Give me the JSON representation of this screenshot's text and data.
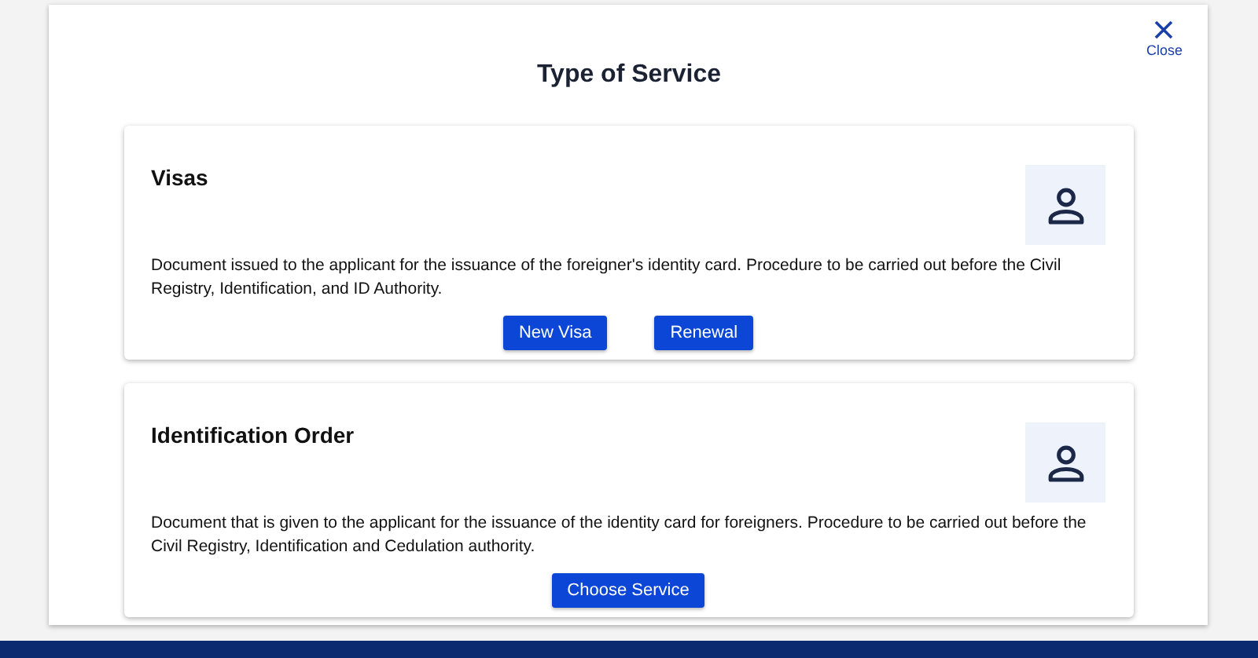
{
  "dialog": {
    "title": "Type of Service",
    "close_label": "Close"
  },
  "services": [
    {
      "title": "Visas",
      "description": "Document issued to the applicant for the issuance of the foreigner's identity card. Procedure to be carried out before the Civil Registry, Identification, and ID Authority.",
      "buttons": [
        "New Visa",
        "Renewal"
      ]
    },
    {
      "title": "Identification Order",
      "description": "Document that is given to the applicant for the issuance of the identity card for foreigners. Procedure to be carried out before the Civil Registry, Identification and Cedulation authority.",
      "buttons": [
        "Choose Service"
      ]
    }
  ]
}
